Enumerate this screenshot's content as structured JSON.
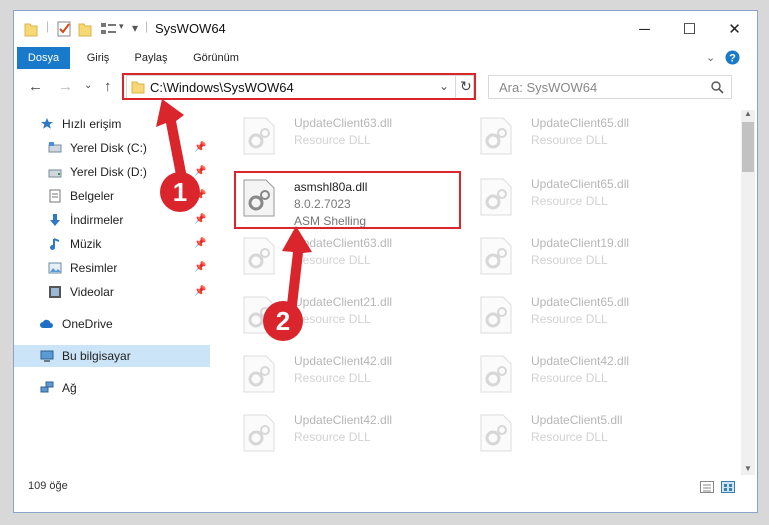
{
  "window": {
    "title": "SysWOW64",
    "minimize": "─",
    "maximize": "☐",
    "close": "✕"
  },
  "ribbon": {
    "tabs": [
      "Dosya",
      "Giriş",
      "Paylaş",
      "Görünüm"
    ]
  },
  "address": {
    "path": "C:\\Windows\\SysWOW64",
    "search_placeholder": "Ara: SysWOW64"
  },
  "nav": {
    "items": [
      {
        "label": "Hızlı erişim",
        "icon": "star-icon"
      },
      {
        "label": "Yerel Disk (C:)",
        "icon": "drive-icon",
        "pinned": true
      },
      {
        "label": "Yerel Disk (D:)",
        "icon": "drive-icon",
        "pinned": true
      },
      {
        "label": "Belgeler",
        "icon": "documents-icon",
        "pinned": true
      },
      {
        "label": "İndirmeler",
        "icon": "downloads-icon",
        "pinned": true
      },
      {
        "label": "Müzik",
        "icon": "music-icon",
        "pinned": true
      },
      {
        "label": "Resimler",
        "icon": "pictures-icon",
        "pinned": true
      },
      {
        "label": "Videolar",
        "icon": "videos-icon",
        "pinned": true
      },
      {
        "label": "OneDrive",
        "icon": "cloud-icon"
      },
      {
        "label": "Bu bilgisayar",
        "icon": "computer-icon",
        "selected": true
      },
      {
        "label": "Ağ",
        "icon": "network-icon"
      }
    ]
  },
  "files": {
    "selected": {
      "name": "asmshl80a.dll",
      "version": "8.0.2.7023",
      "desc": "ASM Shelling"
    },
    "left": [
      {
        "name": "UpdateClient63.dll",
        "type": "Resource DLL"
      },
      {
        "name": "UpdateClient63.dll",
        "type": "Resource DLL"
      },
      {
        "name": "UpdateClient21.dll",
        "type": "Resource DLL"
      },
      {
        "name": "UpdateClient42.dll",
        "type": "Resource DLL"
      },
      {
        "name": "UpdateClient42.dll",
        "type": "Resource DLL"
      }
    ],
    "right": [
      {
        "name": "UpdateClient65.dll",
        "type": "Resource DLL"
      },
      {
        "name": "UpdateClient65.dll",
        "type": "Resource DLL"
      },
      {
        "name": "UpdateClient19.dll",
        "type": "Resource DLL"
      },
      {
        "name": "UpdateClient65.dll",
        "type": "Resource DLL"
      },
      {
        "name": "UpdateClient42.dll",
        "type": "Resource DLL"
      },
      {
        "name": "UpdateClient5.dll",
        "type": "Resource DLL"
      }
    ]
  },
  "status": {
    "count": "109 öğe"
  },
  "annotations": {
    "step1": "1",
    "step2": "2",
    "color": "#d9252b"
  }
}
